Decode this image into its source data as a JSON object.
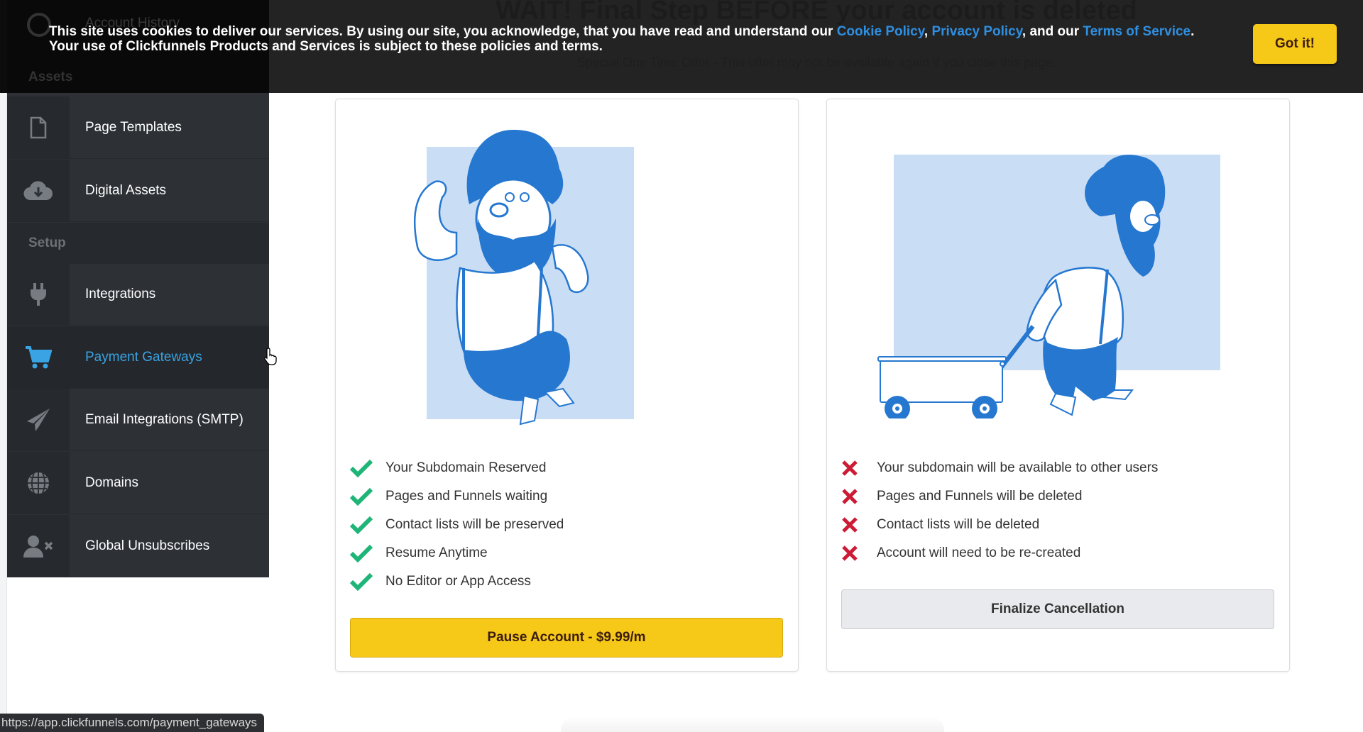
{
  "page": {
    "title": "WAIT! Final Step BEFORE your account is deleted",
    "subtitle": "Special One Time Offer - This offer may not be available again if you close this page."
  },
  "sidebar": {
    "hidden_item": "Account History",
    "hidden_section": "Assets",
    "items": [
      {
        "label": "Page Templates",
        "icon": "file-icon"
      },
      {
        "label": "Digital Assets",
        "icon": "cloud-download-icon"
      },
      {
        "label": "Integrations",
        "icon": "plug-icon"
      },
      {
        "label": "Payment Gateways",
        "icon": "shopping-cart-icon",
        "active": true
      },
      {
        "label": "Email Integrations (SMTP)",
        "icon": "paper-plane-icon"
      },
      {
        "label": "Domains",
        "icon": "globe-icon"
      },
      {
        "label": "Global Unsubscribes",
        "icon": "user-times-icon"
      }
    ],
    "section_setup": "Setup"
  },
  "cookie": {
    "text_before": "This site uses cookies to deliver our services. By using our site, you acknowledge, that you have read and understand our ",
    "cookie_policy": "Cookie Policy",
    "sep1": ", ",
    "privacy_policy": "Privacy Policy",
    "sep2": ", and our ",
    "terms": "Terms of Service",
    "text_after": ". Your use of Clickfunnels Products and Services is subject to these policies and terms.",
    "button": "Got it!"
  },
  "pause_card": {
    "features": [
      "Your Subdomain Reserved",
      "Pages and Funnels waiting",
      "Contact lists will be preserved",
      "Resume Anytime",
      "No Editor or App Access"
    ],
    "button": "Pause Account - $9.99/m"
  },
  "cancel_card": {
    "consequences": [
      "Your subdomain will be available to other users",
      "Pages and Funnels will be deleted",
      "Contact lists will be deleted",
      "Account will need to be re-created"
    ],
    "button": "Finalize Cancellation"
  },
  "status_bar": {
    "url": "https://app.clickfunnels.com/payment_gateways"
  },
  "colors": {
    "accent_blue": "#3aa3e3",
    "button_yellow": "#f6c818",
    "check_green": "#1fb578",
    "cross_red": "#cc1b35",
    "illustration_blue": "#2577d0",
    "illustration_bg": "#c9ddf5"
  }
}
